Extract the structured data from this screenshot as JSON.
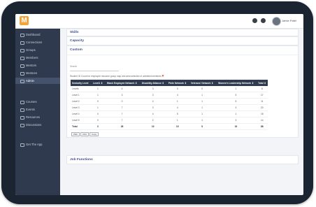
{
  "app": {
    "logo_letter": "M",
    "user_name": "Jamie Patel"
  },
  "sidebar": {
    "items": [
      {
        "label": "Dashboard",
        "icon": "home-icon"
      },
      {
        "label": "Connections",
        "icon": "link-icon"
      },
      {
        "label": "Groups",
        "icon": "group-icon"
      },
      {
        "label": "Members",
        "icon": "users-icon"
      },
      {
        "label": "Mentors",
        "icon": "user-icon"
      },
      {
        "label": "Mentees",
        "icon": "user-icon"
      },
      {
        "label": "Admin",
        "icon": "gear-icon",
        "active": true
      },
      {
        "label": "Courses",
        "icon": "book-icon"
      },
      {
        "label": "Events",
        "icon": "calendar-icon"
      },
      {
        "label": "Resources",
        "icon": "folder-icon"
      },
      {
        "label": "Discussions",
        "icon": "chat-icon"
      },
      {
        "label": "Get The App",
        "icon": "phone-icon"
      }
    ]
  },
  "sections": {
    "skills": "Skills",
    "capacity": "Capacity",
    "custom": "Custom",
    "job_functions": "Job Functions"
  },
  "custom_panel": {
    "search_label": "Search",
    "note": "Student ID Count for employee resource group map and area selected of unlimited members"
  },
  "table": {
    "headers": [
      "Seniority Level",
      "Level1 ⇕",
      "Black Employee Network ⇕",
      "Disability Alliance ⇕",
      "Pride Network ⇕",
      "Veterans' Network ⇕",
      "Women's Leadership Network ⇕",
      "Total ⇕"
    ],
    "rows": [
      [
        "Levels",
        "1",
        "4",
        "3",
        "0",
        "0",
        "1",
        "8"
      ],
      [
        "Level 1",
        "1",
        "3",
        "3",
        "4",
        "1",
        "5",
        "17"
      ],
      [
        "Level 2",
        "0",
        "0",
        "4",
        "1",
        "1",
        "5",
        "11"
      ],
      [
        "Level 3",
        "1",
        "7",
        "3",
        "4",
        "1",
        "4",
        "20"
      ],
      [
        "Level 4",
        "0",
        "7",
        "4",
        "5",
        "1",
        "1",
        "18"
      ],
      [
        "Level 5",
        "0",
        "7",
        "2",
        "1",
        "1",
        "3",
        "14"
      ],
      [
        "Total",
        "3",
        "28",
        "19",
        "15",
        "5",
        "19",
        "88"
      ]
    ]
  },
  "exports": [
    "PDF",
    "CSV",
    "Copy"
  ]
}
